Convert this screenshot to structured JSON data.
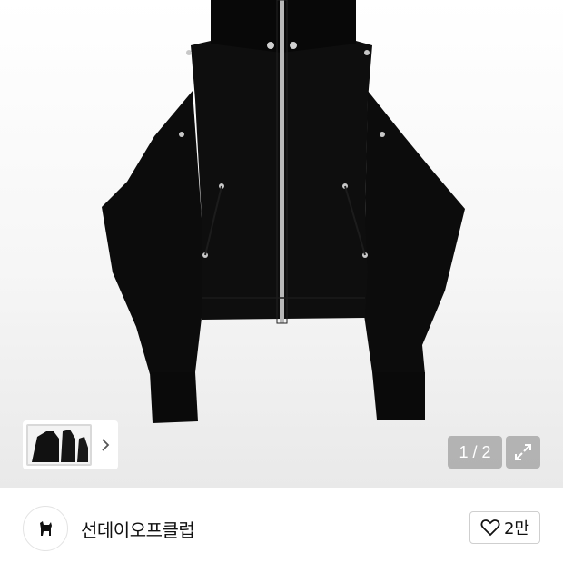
{
  "gallery": {
    "image_alt": "black zip-up hoodie",
    "pager": "1 / 2",
    "expand_icon": "expand-icon",
    "thumbnail_next_icon": "chevron-right-icon"
  },
  "store": {
    "name": "선데이오프클럽",
    "logo_icon": "dog-logo-icon"
  },
  "like": {
    "icon": "heart-icon",
    "count": "2만"
  },
  "colors": {
    "garment": "#0c0c0c",
    "zipper": "#b8b8b8",
    "overlay": "#6e6e6e"
  }
}
